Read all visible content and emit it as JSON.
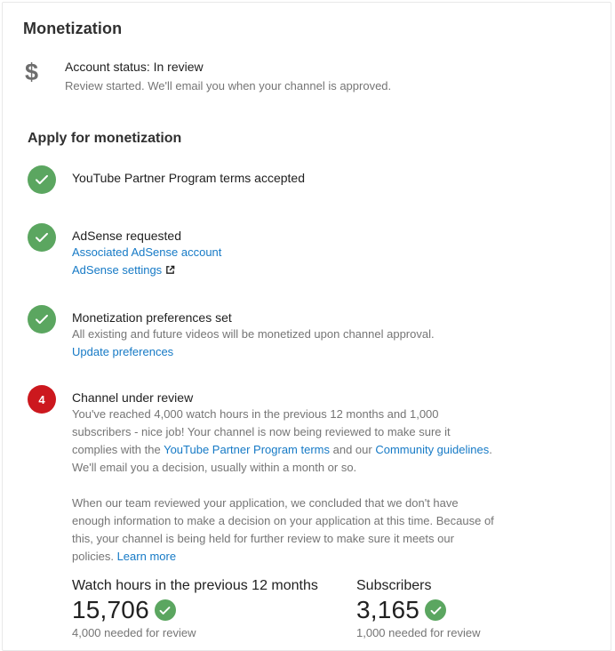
{
  "page": {
    "title": "Monetization"
  },
  "account": {
    "icon": "dollar-icon",
    "status": "Account status: In review",
    "detail": "Review started. We'll email you when your channel is approved."
  },
  "apply": {
    "title": "Apply for monetization",
    "steps": [
      {
        "state": "done",
        "icon": "check-icon",
        "title": "YouTube Partner Program terms accepted"
      },
      {
        "state": "done",
        "icon": "check-icon",
        "title": "AdSense requested",
        "link1": "Associated AdSense account",
        "link2": "AdSense settings",
        "link2_icon": "external-link-icon"
      },
      {
        "state": "done",
        "icon": "check-icon",
        "title": "Monetization preferences set",
        "text": "All existing and future videos will be monetized upon channel approval.",
        "link": "Update preferences"
      },
      {
        "state": "pending",
        "number": "4",
        "title": "Channel under review",
        "p1_a": "You've reached 4,000 watch hours in the previous 12 months and 1,000 subscribers - nice job! Your channel is now being reviewed to make sure it complies with the ",
        "p1_link1": "YouTube Partner Program terms",
        "p1_b": " and our ",
        "p1_link2": "Community guidelines",
        "p1_c": ". We'll email you a decision, usually within a month or so.",
        "p2": "When our team reviewed your application, we concluded that we don't have enough information to make a decision on your application at this time. Because of this, your channel is being held for further review to make sure it meets our policies. ",
        "p2_link": "Learn more"
      }
    ]
  },
  "stats": {
    "watch_hours": {
      "label": "Watch hours in the previous 12 months",
      "value": "15,706",
      "needed": "4,000 needed for review"
    },
    "subscribers": {
      "label": "Subscribers",
      "value": "3,165",
      "needed": "1,000 needed for review"
    }
  },
  "colors": {
    "check_green": "#5ba660",
    "pending_red": "#cc181e",
    "link_blue": "#167ac6"
  }
}
